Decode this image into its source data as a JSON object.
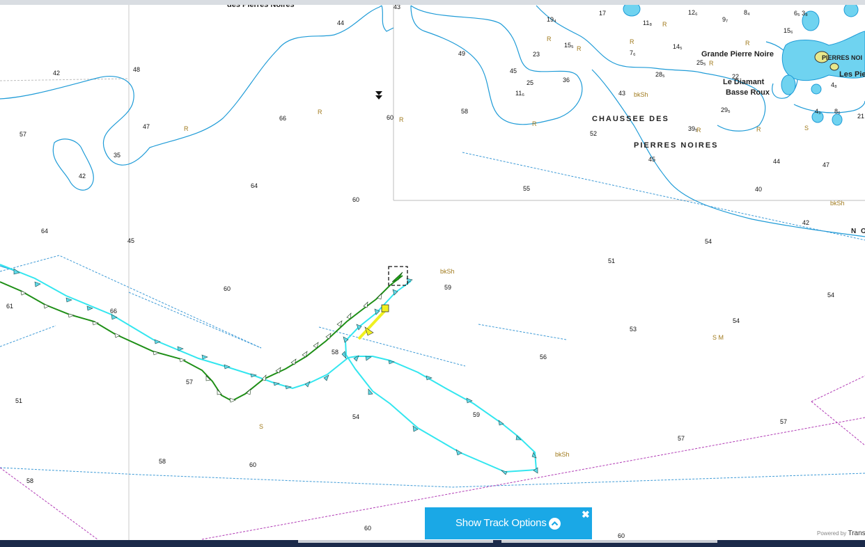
{
  "map": {
    "soundings": [
      "44",
      "42",
      "48",
      "47",
      "57",
      "35",
      "42",
      "66",
      "64",
      "60",
      "60",
      "64",
      "61",
      "66",
      "60",
      "57",
      "51",
      "58",
      "60",
      "58",
      "54",
      "58",
      "56",
      "59",
      "51",
      "53",
      "54",
      "54",
      "54",
      "57",
      "57",
      "59",
      "60",
      "60",
      "55",
      "45",
      "40",
      "44",
      "47",
      "42",
      "43",
      "52",
      "58",
      "49",
      "45",
      "36",
      "25",
      "23",
      "17",
      "45",
      "43"
    ],
    "rock_labels": [
      "R",
      "R",
      "R",
      "R",
      "R",
      "R",
      "R",
      "R",
      "R",
      "R",
      "R",
      "R"
    ],
    "seabed_labels": [
      "bkSh",
      "bkSh",
      "bkSh",
      "bkSh",
      "S",
      "S M",
      "S"
    ],
    "place_names": {
      "chaussee_line1": "CHAUSSEE DES",
      "chaussee_line2": "PIERRES NOIRES",
      "top_partial": "des Pierres Noires",
      "grande_pierre_noire": "Grande Pierre Noire",
      "le_diamant": "Le Diamant",
      "basse_roux": "Basse Roux",
      "les_pierres_partial": "Les Pie",
      "no_partial": "N O",
      "pierres_noires_partial": "PIERRES NOI"
    },
    "colors": {
      "depth_contour": "#1e9bd7",
      "shallow_fill": "#6fd3f0",
      "drying_fill": "#e8e88c",
      "track_cyan": "#33e6ef",
      "track_green": "#1e8f16",
      "traffic_line": "#3d9ad6",
      "boundary_line": "#b13bb5",
      "accent_button": "#1aa8e6"
    }
  },
  "track_options": {
    "label": "Show Track Options",
    "expand_icon": "chevron-up-icon",
    "close_icon": "close-icon",
    "close_glyph": "✖"
  },
  "attribution": {
    "prefix": "Powered by",
    "brand": "Transa"
  }
}
